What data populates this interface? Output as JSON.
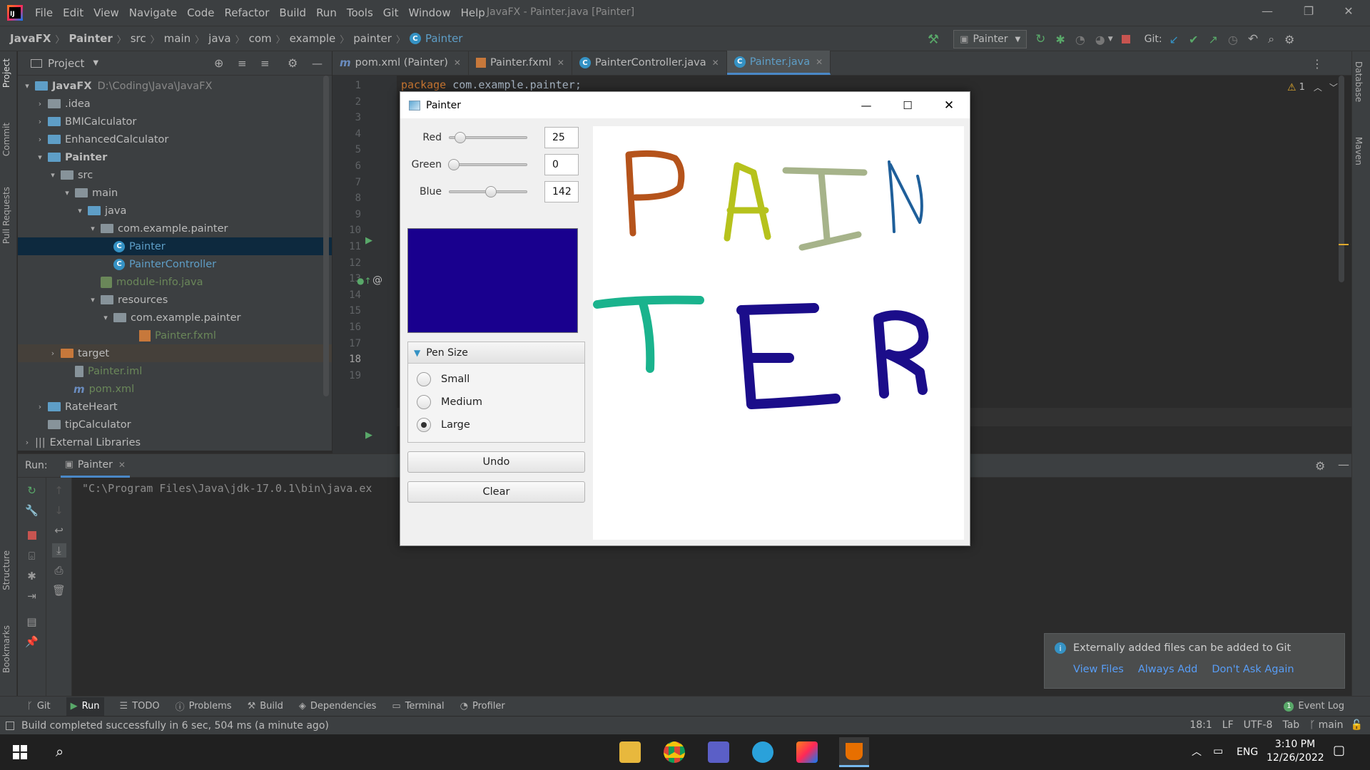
{
  "menubar": {
    "logo": "IJ",
    "items": [
      "File",
      "Edit",
      "View",
      "Navigate",
      "Code",
      "Refactor",
      "Build",
      "Run",
      "Tools",
      "Git",
      "Window",
      "Help"
    ],
    "window_title": "JavaFX - Painter.java [Painter]"
  },
  "navbar": {
    "breadcrumbs": [
      "JavaFX",
      "Painter",
      "src",
      "main",
      "java",
      "com",
      "example",
      "painter",
      "Painter"
    ],
    "run_config": "Painter",
    "git_label": "Git:"
  },
  "left_strip": {
    "project": "Project",
    "commit": "Commit",
    "pull_requests": "Pull Requests",
    "structure": "Structure",
    "bookmarks": "Bookmarks"
  },
  "right_strip": {
    "database": "Database",
    "maven": "Maven"
  },
  "project_panel": {
    "title": "Project",
    "tree": [
      {
        "label": "JavaFX",
        "path": "D:\\Coding\\Java\\JavaFX"
      },
      {
        "label": ".idea"
      },
      {
        "label": "BMICalculator"
      },
      {
        "label": "EnhancedCalculator"
      },
      {
        "label": "Painter"
      },
      {
        "label": "src"
      },
      {
        "label": "main"
      },
      {
        "label": "java"
      },
      {
        "label": "com.example.painter"
      },
      {
        "label": "Painter"
      },
      {
        "label": "PainterController"
      },
      {
        "label": "module-info.java"
      },
      {
        "label": "resources"
      },
      {
        "label": "com.example.painter"
      },
      {
        "label": "Painter.fxml"
      },
      {
        "label": "target"
      },
      {
        "label": "Painter.iml"
      },
      {
        "label": "pom.xml"
      },
      {
        "label": "RateHeart"
      },
      {
        "label": "tipCalculator"
      },
      {
        "label": "External Libraries"
      }
    ]
  },
  "editor": {
    "tabs": [
      {
        "label": "pom.xml (Painter)",
        "icon": "m"
      },
      {
        "label": "Painter.fxml",
        "icon": "fxml"
      },
      {
        "label": "PainterController.java",
        "icon": "c"
      },
      {
        "label": "Painter.java",
        "icon": "c"
      }
    ],
    "line_numbers": [
      "1",
      "2",
      "3",
      "4",
      "5",
      "6",
      "7",
      "8",
      "9",
      "10",
      "11",
      "12",
      "13",
      "14",
      "15",
      "16",
      "17",
      "18",
      "19"
    ],
    "code_line_1_keyword": "package",
    "code_line_1_rest": " com.example.painter;",
    "warnings": "1"
  },
  "run_panel": {
    "label": "Run:",
    "tab": "Painter",
    "console_text": "\"C:\\Program Files\\Java\\jdk-17.0.1\\bin\\java.ex"
  },
  "tool_windows": [
    "Git",
    "Run",
    "TODO",
    "Problems",
    "Build",
    "Dependencies",
    "Terminal",
    "Profiler"
  ],
  "event_log": {
    "count": "1",
    "label": "Event Log"
  },
  "status": {
    "message": "Build completed successfully in 6 sec, 504 ms (a minute ago)",
    "position": "18:1",
    "line_sep": "LF",
    "encoding": "UTF-8",
    "indent": "Tab",
    "branch": "main"
  },
  "notification": {
    "text": "Externally added files can be added to Git",
    "links": [
      "View Files",
      "Always Add",
      "Don't Ask Again"
    ]
  },
  "painter_app": {
    "title": "Painter",
    "red": {
      "label": "Red",
      "value": "25",
      "fraction": 0.098
    },
    "green": {
      "label": "Green",
      "value": "0",
      "fraction": 0.0
    },
    "blue": {
      "label": "Blue",
      "value": "142",
      "fraction": 0.557
    },
    "color_hex": "#19008e",
    "pen_size": {
      "title": "Pen Size",
      "options": [
        "Small",
        "Medium",
        "Large"
      ],
      "selected": "Large"
    },
    "undo_label": "Undo",
    "clear_label": "Clear",
    "stroke_colors": [
      "#b5531b",
      "#b6c21c",
      "#a6b38a",
      "#1f5f9a",
      "#1ab38d",
      "#1b0d8a"
    ]
  },
  "taskbar": {
    "language": "ENG",
    "time": "3:10 PM",
    "date": "12/26/2022"
  },
  "colors": {
    "accent": "#4a88c7",
    "selection": "#0d293e",
    "link": "#589df6"
  }
}
